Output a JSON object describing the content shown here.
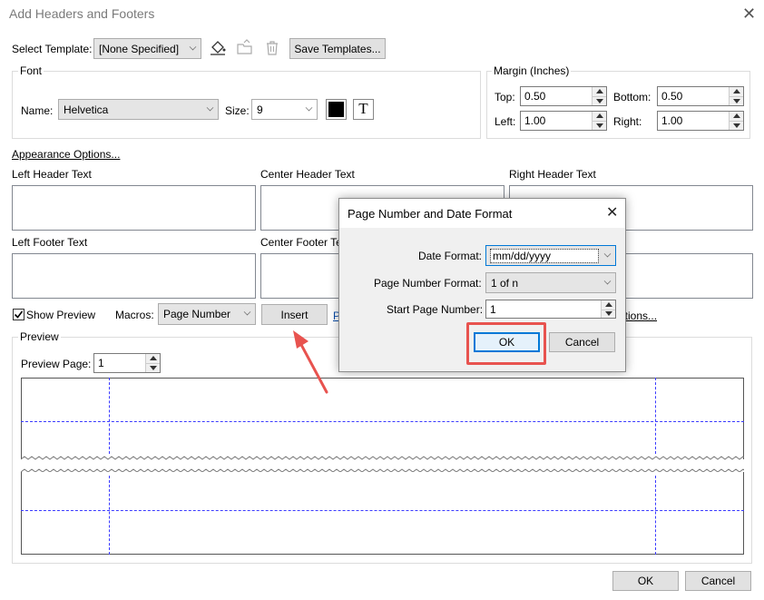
{
  "window": {
    "title": "Add Headers and Footers"
  },
  "template": {
    "label": "Select Template:",
    "value": "[None Specified]",
    "save_button": "Save Templates..."
  },
  "font": {
    "group_title": "Font",
    "name_label": "Name:",
    "name_value": "Helvetica",
    "size_label": "Size:",
    "size_value": "9",
    "color": "#000000"
  },
  "margin": {
    "group_title": "Margin (Inches)",
    "top_label": "Top:",
    "top_value": "0.50",
    "bottom_label": "Bottom:",
    "bottom_value": "0.50",
    "left_label": "Left:",
    "left_value": "1.00",
    "right_label": "Right:",
    "right_value": "1.00"
  },
  "appearance_link": "Appearance Options...",
  "text_areas": {
    "left_header": "Left Header Text",
    "center_header": "Center Header Text",
    "right_header": "Right Header Text",
    "left_footer": "Left Footer Text",
    "center_footer": "Center Footer Te"
  },
  "controls": {
    "show_preview": "Show Preview",
    "show_preview_checked": true,
    "macros_label": "Macros:",
    "macros_value": "Page Number",
    "insert_button": "Insert",
    "partial_link_left": "P",
    "partial_link_right": "ptions..."
  },
  "preview": {
    "group_title": "Preview",
    "page_label": "Preview Page:",
    "page_value": "1"
  },
  "footer_buttons": {
    "ok": "OK",
    "cancel": "Cancel"
  },
  "dialog": {
    "title": "Page Number and Date Format",
    "date_format_label": "Date Format:",
    "date_format_value": "mm/dd/yyyy",
    "page_number_format_label": "Page Number Format:",
    "page_number_format_value": "1 of n",
    "start_page_label": "Start Page Number:",
    "start_page_value": "1",
    "ok": "OK",
    "cancel": "Cancel"
  },
  "colors": {
    "highlight": "#e8534f",
    "guide_lines": "#3a3aff",
    "focus": "#0078d7"
  },
  "icons": [
    "paint-bucket-icon",
    "folder-open-icon",
    "trash-icon",
    "text-type-icon",
    "close-icon",
    "annotation-arrow"
  ]
}
